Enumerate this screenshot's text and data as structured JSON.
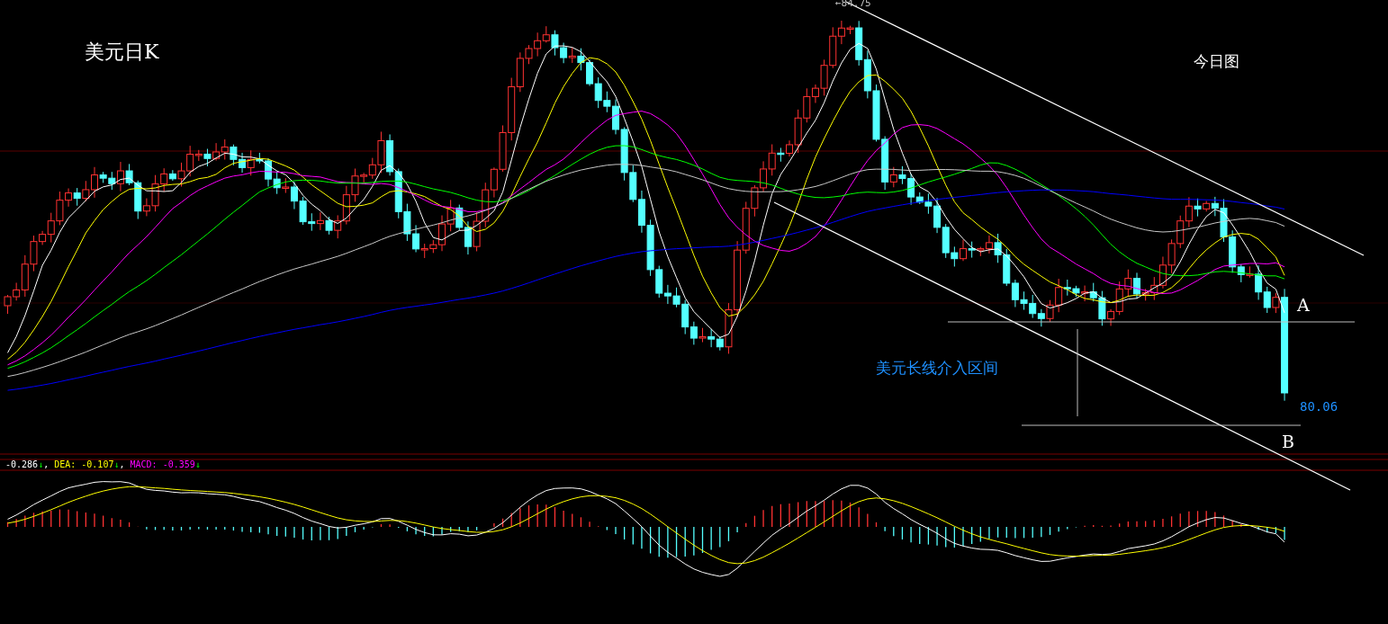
{
  "title": "美元日K",
  "view_label": "今日图",
  "high_label": "←84.75",
  "points": [
    {
      "text": "A"
    },
    {
      "text": "B"
    }
  ],
  "zone_label": "美元长线介入区间",
  "last_price": "80.06",
  "macd_legend": {
    "separator": ",",
    "items": [
      {
        "text": "-0.286",
        "arrow": "↓"
      },
      {
        "text": "DEA: -0.107",
        "arrow": "↓"
      },
      {
        "text": "MACD: -0.359",
        "arrow": "↓"
      }
    ]
  }
}
